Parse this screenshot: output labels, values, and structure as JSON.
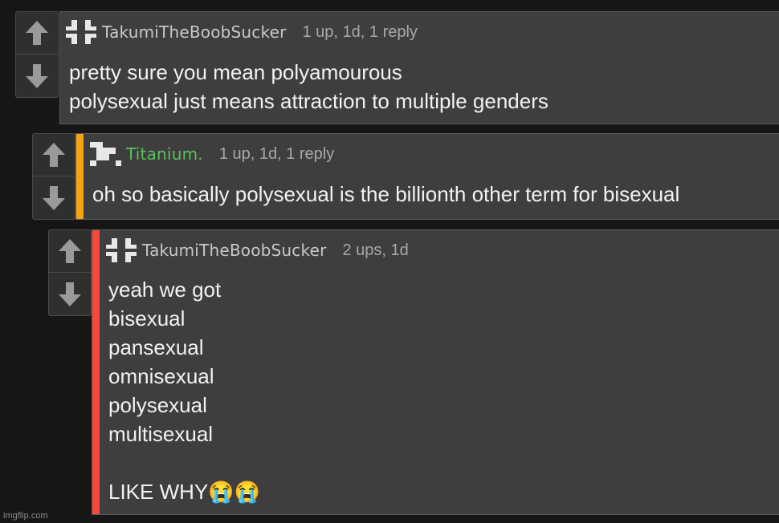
{
  "thread": {
    "comments": [
      {
        "username": "TakumiTheBoobSucker",
        "stats": "1 up, 1d, 1 reply",
        "body_lines": [
          "pretty sure you mean polyamourous",
          "polysexual just means attraction to multiple genders"
        ],
        "stripe_color": "",
        "username_color": "#c8c8c8",
        "avatar_icon": "pinwheel-avatar-icon"
      },
      {
        "username": "Titanium.",
        "stats": "1 up, 1d, 1 reply",
        "body_lines": [
          "oh so basically polysexual is the billionth other term for bisexual"
        ],
        "stripe_color": "#f5a312",
        "username_color": "#5cc15c",
        "avatar_icon": "pixel-x-avatar-icon"
      },
      {
        "username": "TakumiTheBoobSucker",
        "stats": "2 ups, 1d",
        "body_lines": [
          "yeah we got",
          "bisexual",
          "pansexual",
          "omnisexual",
          "polysexual",
          "multisexual",
          "",
          "LIKE WHY😭😭"
        ],
        "stripe_color": "#f44a3a",
        "username_color": "#c8c8c8",
        "avatar_icon": "pinwheel-avatar-icon"
      }
    ]
  },
  "watermark": "imgflip.com",
  "icons": {
    "upvote": "upvote-arrow-icon",
    "downvote": "downvote-arrow-icon"
  }
}
